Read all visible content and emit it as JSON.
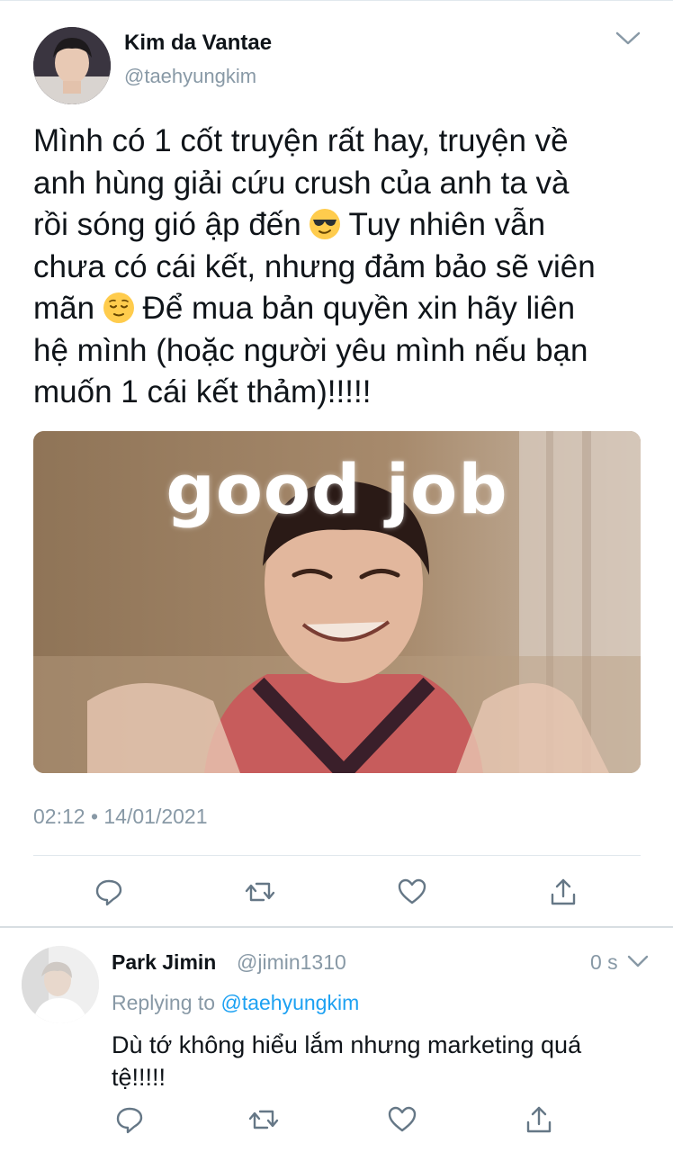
{
  "tweet": {
    "display_name": "Kim da Vantae",
    "handle": "@taehyungkim",
    "text_parts": [
      "Mình có 1 cốt truyện rất hay, truyện về\nanh hùng giải cứu crush của anh ta và\nrồi sóng gió ập đến ",
      " Tuy nhiên vẫn\nchưa có cái kết, nhưng đảm bảo sẽ viên\nmãn ",
      "  Để mua bản quyền xin hãy liên\nhệ mình (hoặc người yêu mình nếu bạn\nmuốn 1 cái kết thảm)!!!!!"
    ],
    "emojis": [
      "sunglasses-emoji",
      "relieved-face-emoji"
    ],
    "media_caption": "good job",
    "timestamp": "02:12 • 14/01/2021"
  },
  "actions": [
    "reply-icon",
    "retweet-icon",
    "like-icon",
    "share-icon"
  ],
  "reply": {
    "display_name": "Park Jimin",
    "handle": "@jimin1310",
    "time": "0 s",
    "replying_prefix": "Replying to ",
    "replying_to": "@taehyungkim",
    "text": "Dù tớ không hiểu lắm nhưng marketing quá\ntệ!!!!!"
  },
  "colors": {
    "text": "#0f1419",
    "secondary": "#8899a6",
    "accent": "#1da1f2",
    "divider": "#e1e8ed"
  }
}
